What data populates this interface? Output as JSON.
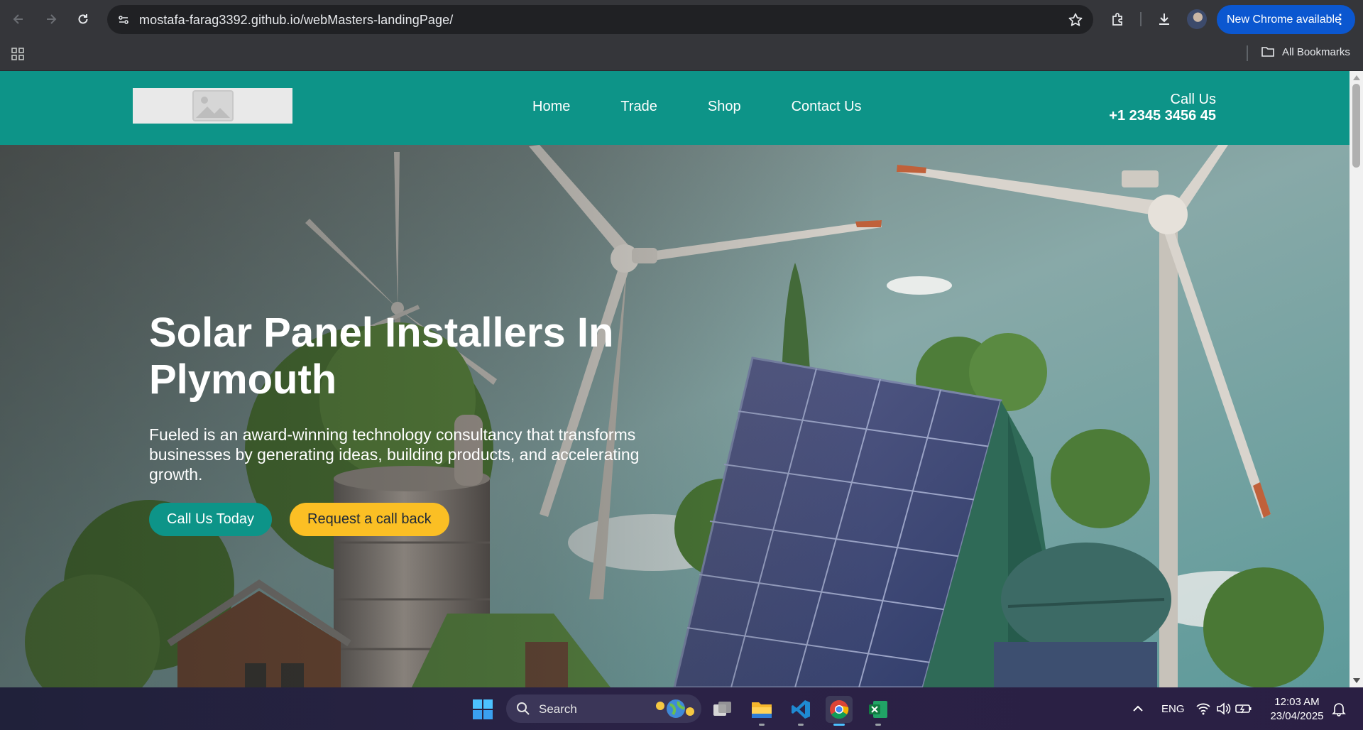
{
  "browser": {
    "url": "mostafa-farag3392.github.io/webMasters-landingPage/",
    "update_label": "New Chrome available",
    "bookmarks_label": "All Bookmarks"
  },
  "site": {
    "nav": [
      "Home",
      "Trade",
      "Shop",
      "Contact Us"
    ],
    "call_label": "Call Us",
    "phone": "+1 2345 3456 45",
    "brand_color": "#0d9488",
    "accent_color": "#fbbf24"
  },
  "hero": {
    "title": "Solar Panel Installers In Plymouth",
    "description": "Fueled is an award-winning technology consultancy that transforms businesses by generating ideas, building products, and accelerating growth.",
    "primary_button": "Call Us Today",
    "secondary_button": "Request a call back"
  },
  "taskbar": {
    "search_placeholder": "Search",
    "language": "ENG",
    "time": "12:03 AM",
    "date": "23/04/2025"
  }
}
